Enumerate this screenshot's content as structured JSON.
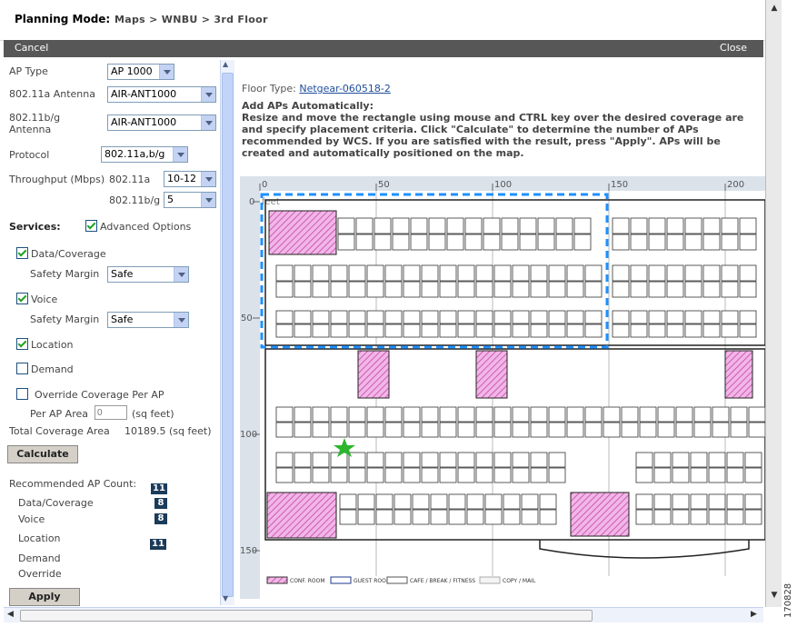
{
  "header": {
    "title": "Planning Mode:",
    "breadcrumb": "Maps > WNBU > 3rd Floor"
  },
  "actionbar": {
    "cancel": "Cancel",
    "close": "Close"
  },
  "form": {
    "ap_type_label": "AP Type",
    "ap_type_value": "AP 1000",
    "a_antenna_label": "802.11a Antenna",
    "a_antenna_value": "AIR-ANT1000",
    "bg_antenna_label_1": "802.11b/g",
    "bg_antenna_label_2": "Antenna",
    "bg_antenna_value": "AIR-ANT1000",
    "protocol_label": "Protocol",
    "protocol_value": "802.11a,b/g",
    "throughput_label": "Throughput (Mbps)",
    "thr_a_label": "802.11a",
    "thr_a_value": "10-12",
    "thr_bg_label": "802.11b/g",
    "thr_bg_value": "5",
    "services_label": "Services:",
    "advanced_label": "Advanced Options",
    "data_coverage_label": "Data/Coverage",
    "safety_margin_label": "Safety Margin",
    "safety_1": "Safe",
    "voice_label": "Voice",
    "safety_2": "Safe",
    "location_label": "Location",
    "demand_label": "Demand",
    "override_label": "Override Coverage Per AP",
    "per_ap_area_label": "Per AP Area",
    "per_ap_area_placeholder": "0",
    "sq_feet_label": "(sq feet)",
    "total_coverage_label": "Total Coverage Area",
    "total_coverage_value": "10189.5 (sq feet)",
    "calculate_label": "Calculate",
    "recommended_label": "Recommended AP Count:",
    "recommended_value": "11",
    "r_data_label": "Data/Coverage",
    "r_data_value": "8",
    "r_voice_label": "Voice",
    "r_voice_value": "8",
    "r_location_label": "Location",
    "r_location_value": "11",
    "r_demand_label": "Demand",
    "r_override_label": "Override",
    "apply_label": "Apply"
  },
  "main": {
    "floor_type_label": "Floor Type:",
    "floor_type_link": "Netgear-060518-2",
    "add_aps_heading": "Add APs Automatically:",
    "instructions": [
      "Resize and move the rectangle using mouse and CTRL key over the desired coverage are",
      "and specify placement criteria. Click \"Calculate\" to determine the number of APs",
      "recommended by WCS. If you are satisfied with the result, press \"Apply\". APs will be",
      "created and automatically positioned on the map."
    ],
    "ruler_top": [
      "0",
      "50",
      "100",
      "150",
      "200"
    ],
    "ruler_left": [
      "0",
      "50",
      "100",
      "150"
    ],
    "ruler_unit": "feet",
    "legend": [
      "CONF. ROOM",
      "GUEST ROOM",
      "CAFE / BREAK / FITNESS",
      "COPY / MAIL"
    ]
  },
  "figure_number": "170828",
  "colors": {
    "actionbar": "#575757",
    "selection": "#1e90ff",
    "conf_room": "#e58ad7",
    "marker": "#2db52d",
    "count_badge": "#1b3b5a"
  }
}
